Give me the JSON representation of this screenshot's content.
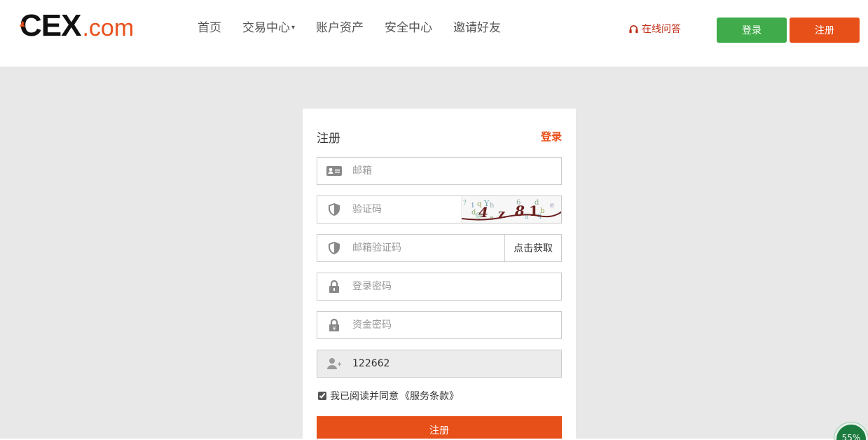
{
  "header": {
    "logo_main": "CEX",
    "logo_suffix": ".com",
    "nav": [
      {
        "label": "首页"
      },
      {
        "label": "交易中心",
        "has_dropdown": true
      },
      {
        "label": "账户资产"
      },
      {
        "label": "安全中心"
      },
      {
        "label": "邀请好友"
      }
    ],
    "support_label": "在线问答",
    "login_button": "登录",
    "register_button": "注册"
  },
  "form": {
    "title": "注册",
    "login_link": "登录",
    "email": {
      "placeholder": "邮箱",
      "icon": "id-card-icon"
    },
    "captcha": {
      "placeholder": "验证码",
      "icon": "shield-icon",
      "image_text": "4 z 8 1"
    },
    "email_code": {
      "placeholder": "邮箱验证码",
      "icon": "shield-icon",
      "get_code_label": "点击获取"
    },
    "login_password": {
      "placeholder": "登录密码",
      "icon": "lock-icon"
    },
    "fund_password": {
      "placeholder": "资金密码",
      "icon": "yuan-lock-icon"
    },
    "invite_code": {
      "value": "122662",
      "icon": "user-add-icon"
    },
    "agree": {
      "checked": true,
      "text": "我已阅读并同意",
      "terms_link": "《服务条款》"
    },
    "submit_label": "注册"
  },
  "progress_badge": {
    "percent": 55,
    "label": "55%"
  },
  "colors": {
    "accent": "#e8501a",
    "green": "#3fab4a",
    "support_red": "#c0301a",
    "page_bg": "#e8e8e8"
  }
}
